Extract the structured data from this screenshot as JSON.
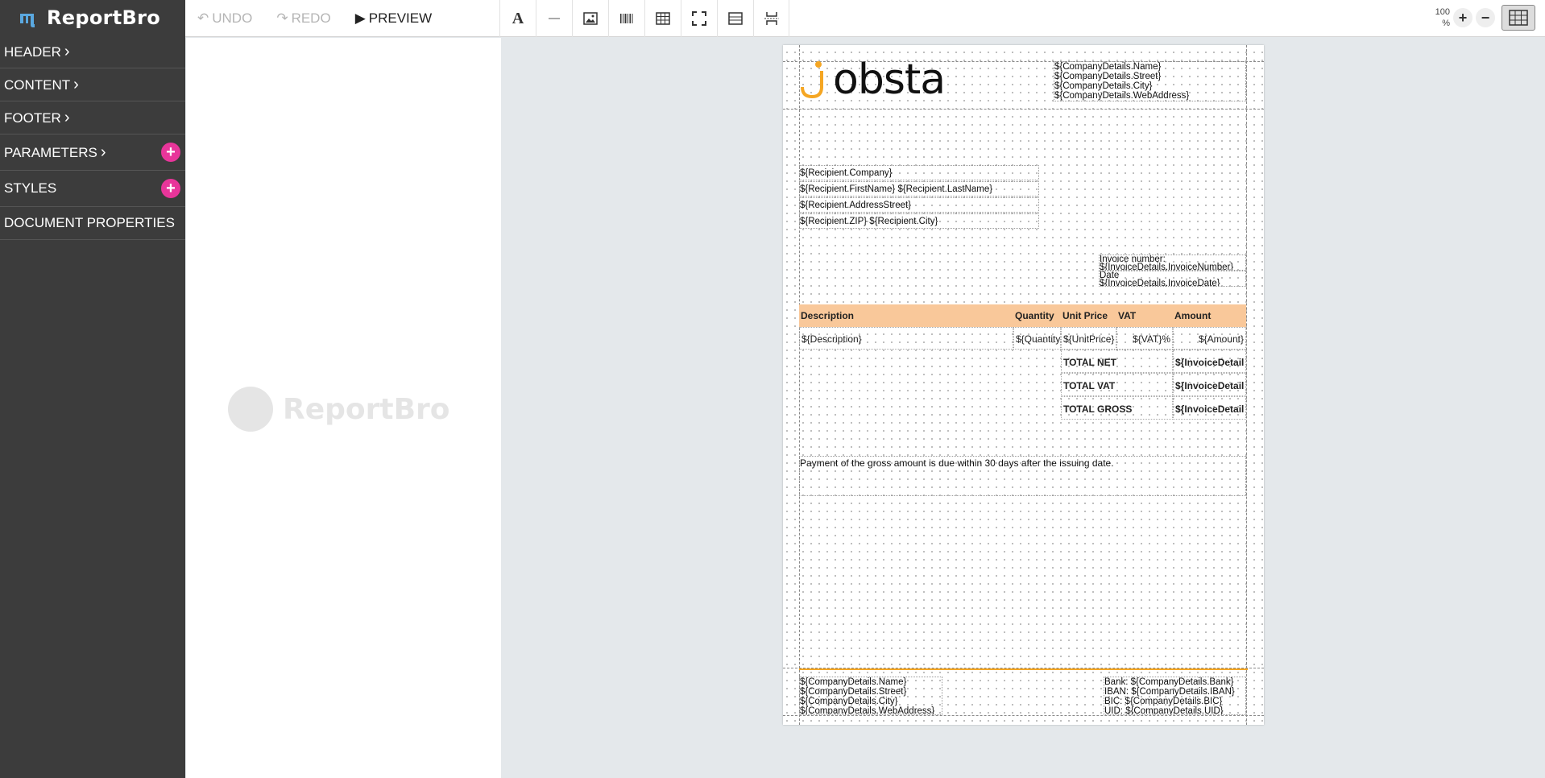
{
  "app": {
    "name": "ReportBro"
  },
  "sidebar": {
    "items": [
      {
        "label": "HEADER",
        "chevron": true,
        "add": false
      },
      {
        "label": "CONTENT",
        "chevron": true,
        "add": false
      },
      {
        "label": "FOOTER",
        "chevron": true,
        "add": false
      },
      {
        "label": "PARAMETERS",
        "chevron": true,
        "add": true
      },
      {
        "label": "STYLES",
        "chevron": false,
        "add": true
      },
      {
        "label": "DOCUMENT PROPERTIES",
        "chevron": false,
        "add": false
      }
    ]
  },
  "toolbar": {
    "undo_label": "UNDO",
    "redo_label": "REDO",
    "preview_label": "PREVIEW",
    "tools": [
      "text-tool-icon",
      "line-tool-icon",
      "image-tool-icon",
      "barcode-tool-icon",
      "table-tool-icon",
      "frame-tool-icon",
      "section-tool-icon",
      "page-break-tool-icon"
    ],
    "zoom_value": "100",
    "zoom_unit": "%"
  },
  "watermark": {
    "text": "ReportBro"
  },
  "document": {
    "logo_text": "obsta",
    "company_header": [
      "${CompanyDetails.Name}",
      "${CompanyDetails.Street}",
      "${CompanyDetails.City}",
      "${CompanyDetails.WebAddress}"
    ],
    "recipient": [
      "${Recipient.Company}",
      "${Recipient.FirstName} ${Recipient.LastName}",
      "${Recipient.AddressStreet}",
      "${Recipient.ZIP} ${Recipient.City}"
    ],
    "invoice_info": [
      "Invoice number:",
      "${InvoiceDetails.InvoiceNumber}",
      "Date",
      "${InvoiceDetails.InvoiceDate}"
    ],
    "table": {
      "headers": [
        "Description",
        "Quantity",
        "Unit Price",
        "VAT",
        "Amount"
      ],
      "row": [
        "${Description}",
        "${Quantity}",
        "${UnitPrice}",
        "${VAT}%",
        "${Amount}"
      ],
      "totals": [
        {
          "label": "TOTAL NET",
          "value": "${InvoiceDetail"
        },
        {
          "label": "TOTAL VAT",
          "value": "${InvoiceDetail"
        },
        {
          "label": "TOTAL GROSS",
          "value": "${InvoiceDetail"
        }
      ]
    },
    "payment_text": "Payment of the gross amount is due within 30 days after the issuing date.",
    "footer_left": [
      "${CompanyDetails.Name}",
      "${CompanyDetails.Street}",
      "${CompanyDetails.City}",
      "${CompanyDetails.WebAddress}"
    ],
    "footer_right": [
      "Bank: ${CompanyDetails.Bank}",
      "IBAN: ${CompanyDetails.IBAN}",
      "BIC: ${CompanyDetails.BIC}",
      "UID: ${CompanyDetails.UID}"
    ]
  },
  "colors": {
    "sidebar_bg": "#3c3c3c",
    "accent_pink": "#e8359a",
    "table_header": "#f9c89a",
    "logo_orange": "#f5a623"
  }
}
